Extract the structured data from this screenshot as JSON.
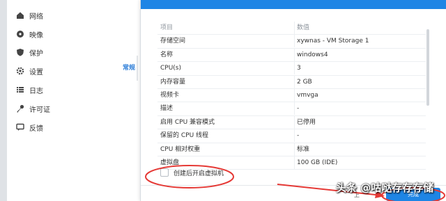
{
  "sidebar": {
    "items": [
      {
        "label": "网络",
        "icon": "house-icon"
      },
      {
        "label": "映像",
        "icon": "disc-icon"
      },
      {
        "label": "保护",
        "icon": "shield-icon"
      },
      {
        "label": "设置",
        "icon": "gear-icon"
      },
      {
        "label": "日志",
        "icon": "list-icon"
      },
      {
        "label": "许可证",
        "icon": "key-icon"
      },
      {
        "label": "反馈",
        "icon": "chat-icon"
      }
    ]
  },
  "background_tab": {
    "label": "常规"
  },
  "summary_table": {
    "header": {
      "key": "项目",
      "value": "数值"
    },
    "rows": [
      {
        "key": "存储空间",
        "value": "xywnas - VM Storage 1"
      },
      {
        "key": "名称",
        "value": "windows4"
      },
      {
        "key": "CPU(s)",
        "value": "3"
      },
      {
        "key": "内存容量",
        "value": "2 GB"
      },
      {
        "key": "视频卡",
        "value": "vmvga"
      },
      {
        "key": "描述",
        "value": "-"
      },
      {
        "key": "启用 CPU 兼容模式",
        "value": "已停用"
      },
      {
        "key": "保留的 CPU 线程",
        "value": "-"
      },
      {
        "key": "CPU 相对权重",
        "value": "标准"
      },
      {
        "key": "虚拟盘",
        "value": "100 GB (IDE)"
      }
    ]
  },
  "options": {
    "start_after_create_label": "创建后开启虚拟机"
  },
  "footer": {
    "cancel_label": "上",
    "ok_label": "完成"
  },
  "watermark": {
    "text": "头条 @咕哒存存存储"
  },
  "colors": {
    "accent": "#1e85e5",
    "annotation_red": "#e53935"
  }
}
